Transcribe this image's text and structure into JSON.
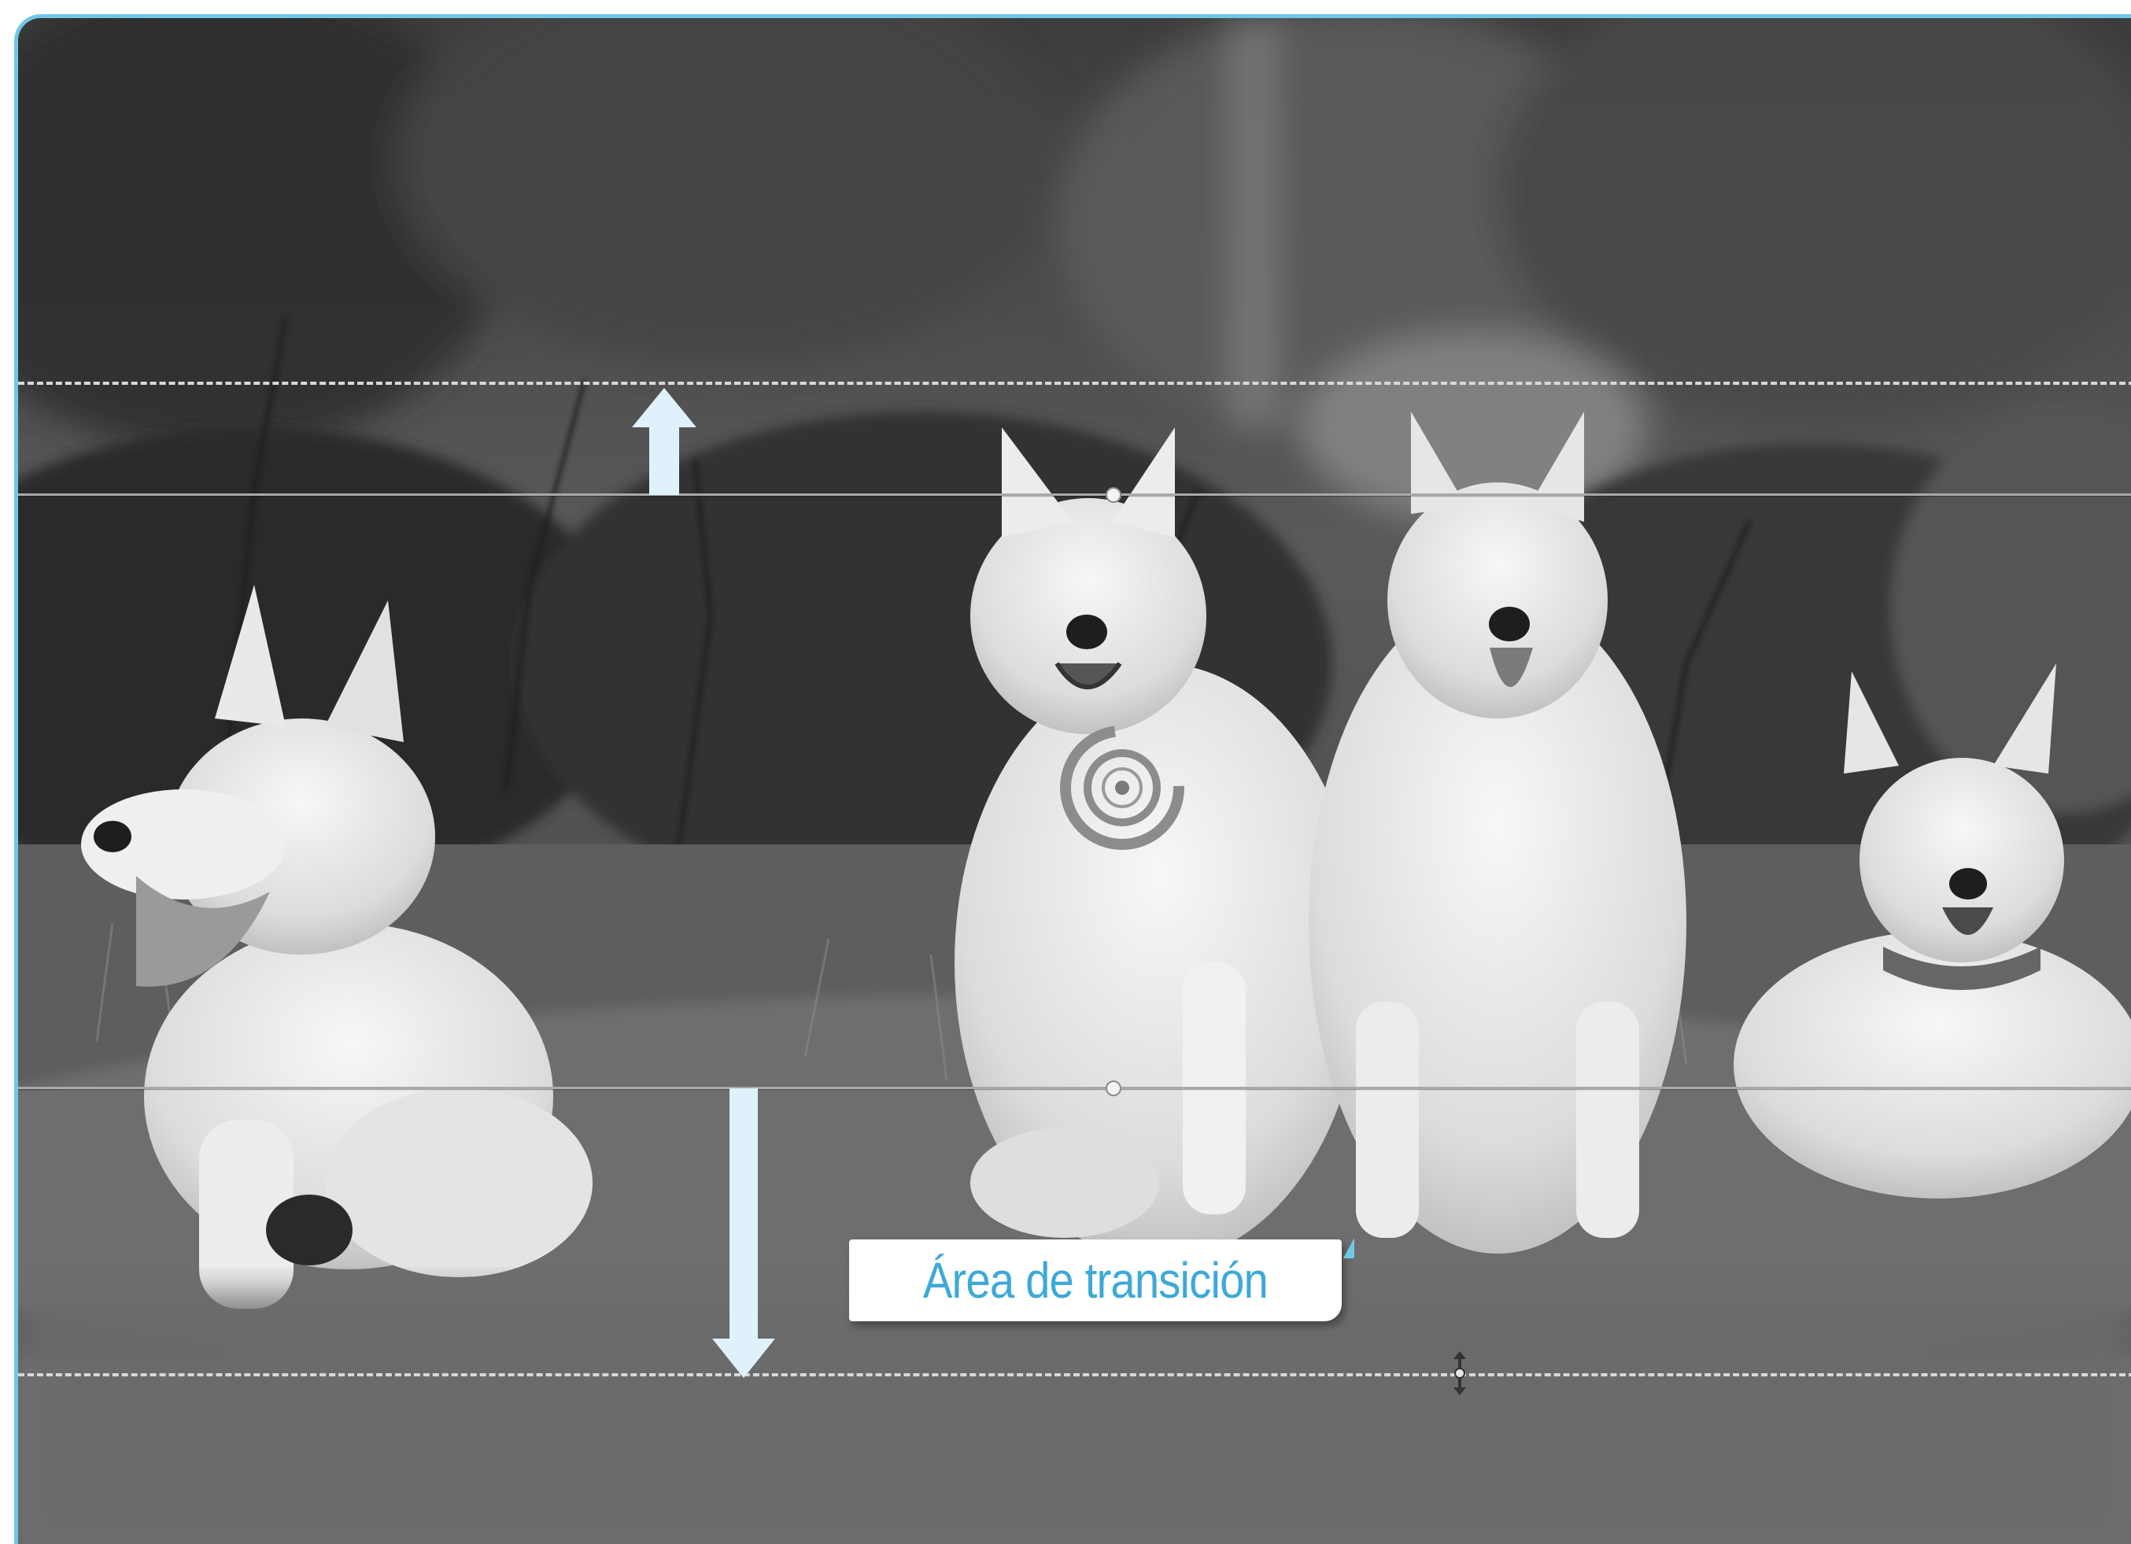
{
  "callout": {
    "label": "Área de transición"
  },
  "colors": {
    "accent": "#6fc8e6",
    "callout_text": "#3da9d8",
    "arrow_fill": "#dff1fb"
  },
  "icons": [
    "focus-target-icon",
    "upward-arrow-icon",
    "downward-arrow-icon",
    "resize-handle-icon"
  ]
}
